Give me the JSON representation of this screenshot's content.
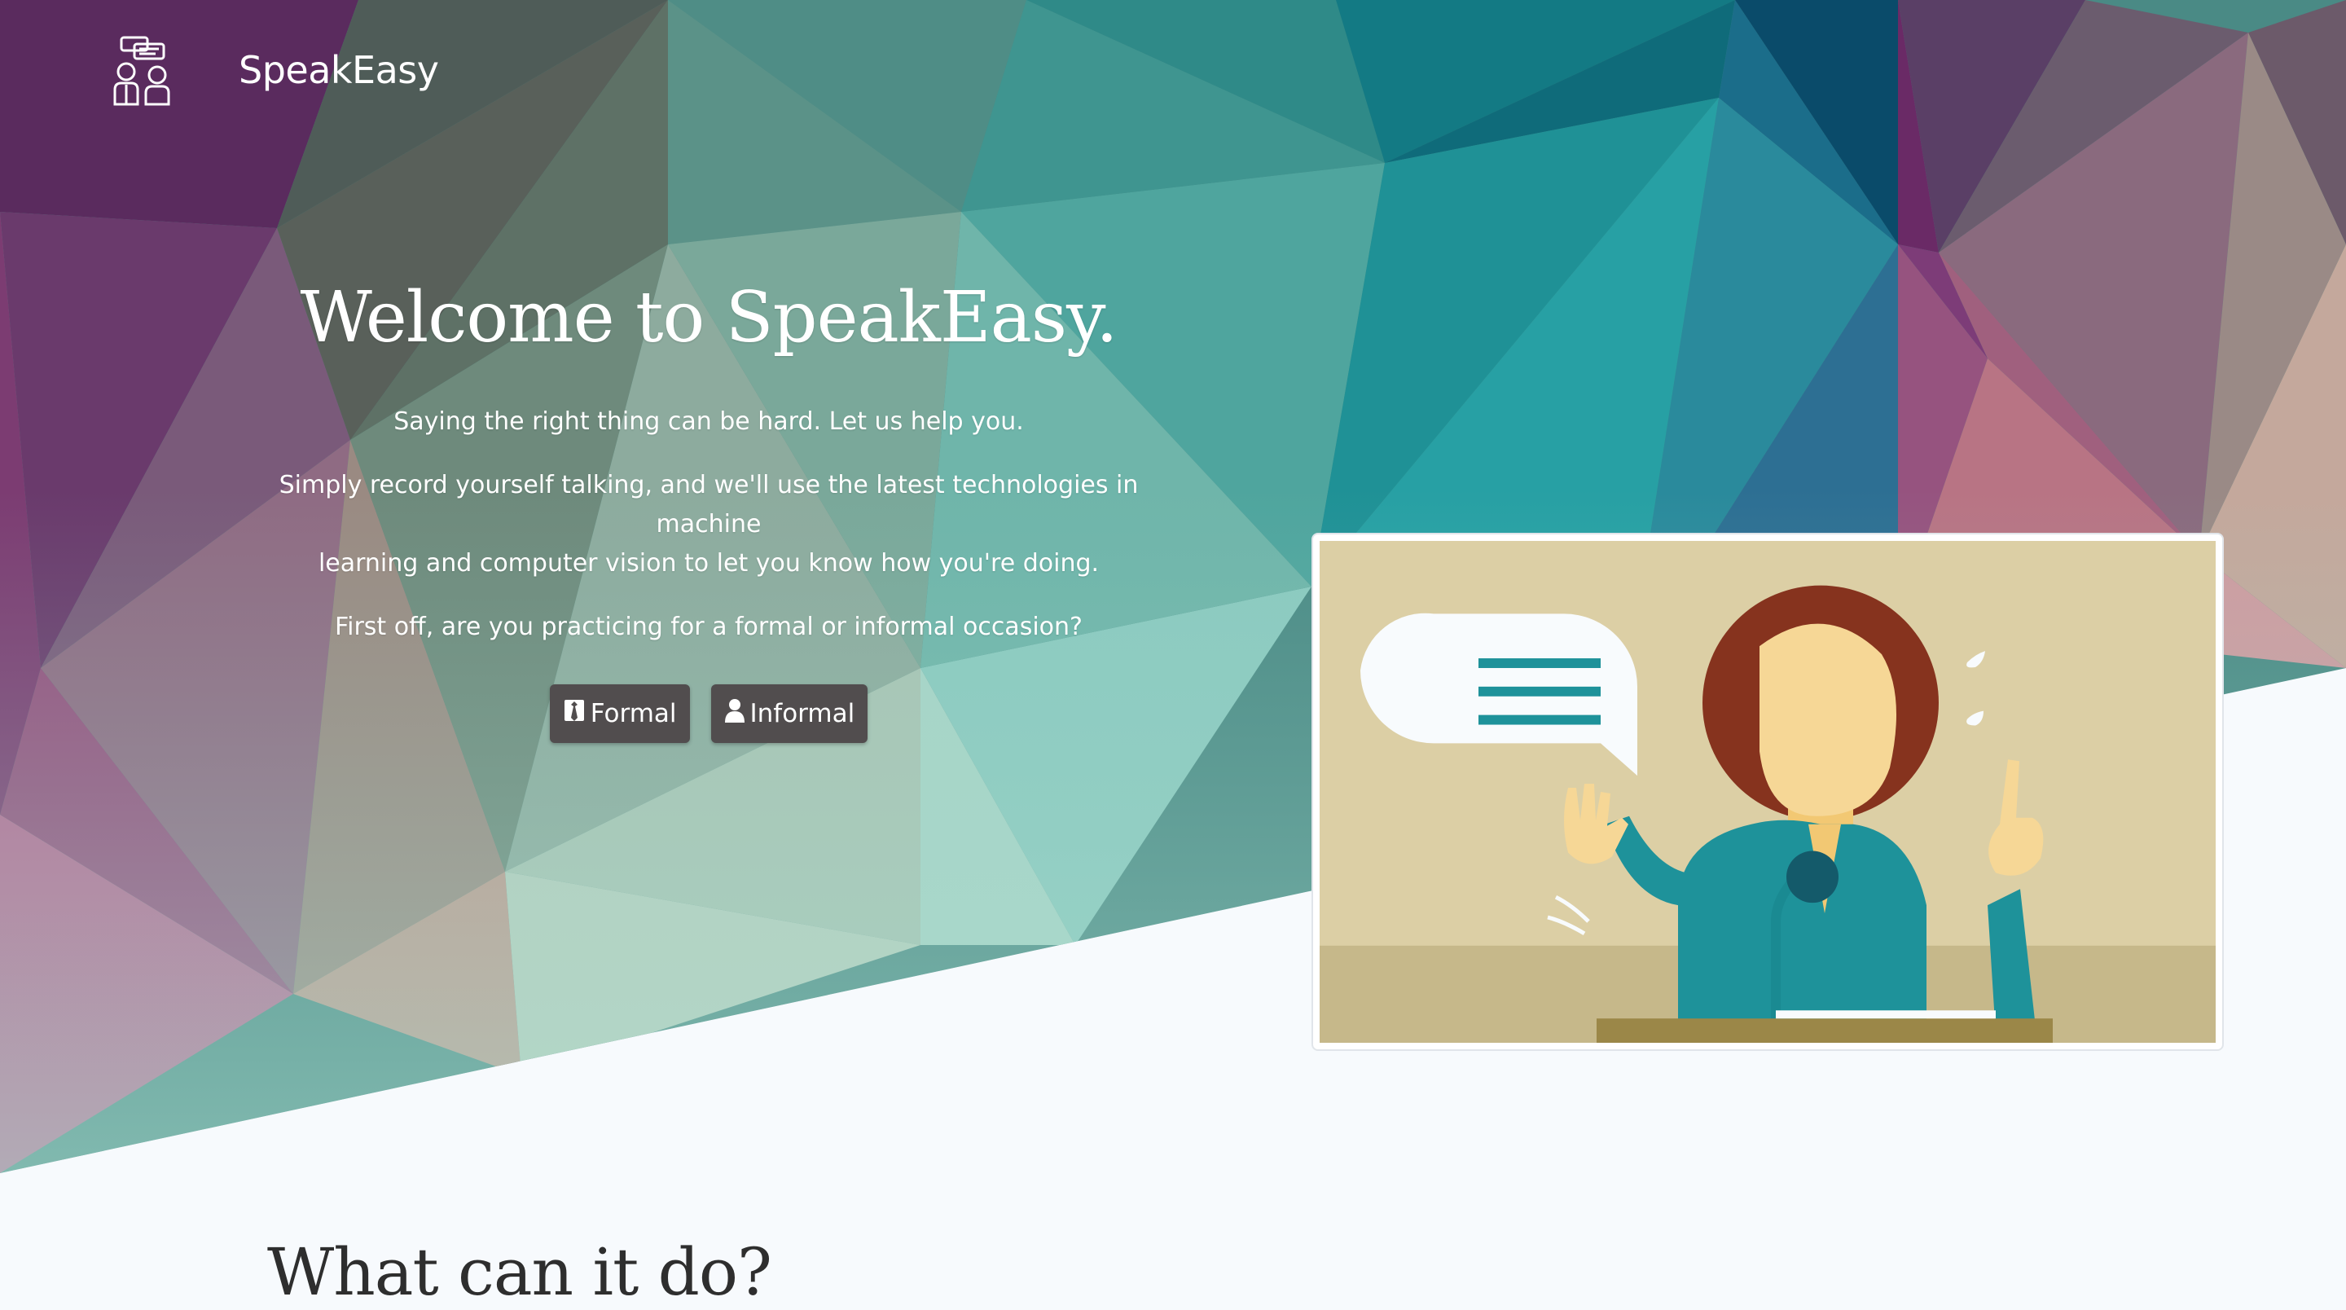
{
  "brand": {
    "name": "SpeakEasy",
    "logo_icon": "two-people-chat-icon"
  },
  "hero": {
    "title": "Welcome to SpeakEasy.",
    "tagline": "Saying the right thing can be hard. Let us help you.",
    "description_line1": "Simply record yourself talking, and we'll use the latest technologies in machine",
    "description_line2": "learning and computer vision to let you know how you're doing.",
    "question": "First off, are you practicing for a formal or informal occasion?",
    "buttons": [
      {
        "label": "Formal",
        "icon": "suit-tie-icon"
      },
      {
        "label": "Informal",
        "icon": "person-icon"
      }
    ]
  },
  "illustration": {
    "subject": "woman-speaking-at-podium"
  },
  "section": {
    "title": "What can it do?"
  },
  "colors": {
    "button_bg": "#514d4e",
    "lower_bg": "#f7fafd",
    "teal": "#1e929a",
    "purple": "#6a2a66"
  }
}
